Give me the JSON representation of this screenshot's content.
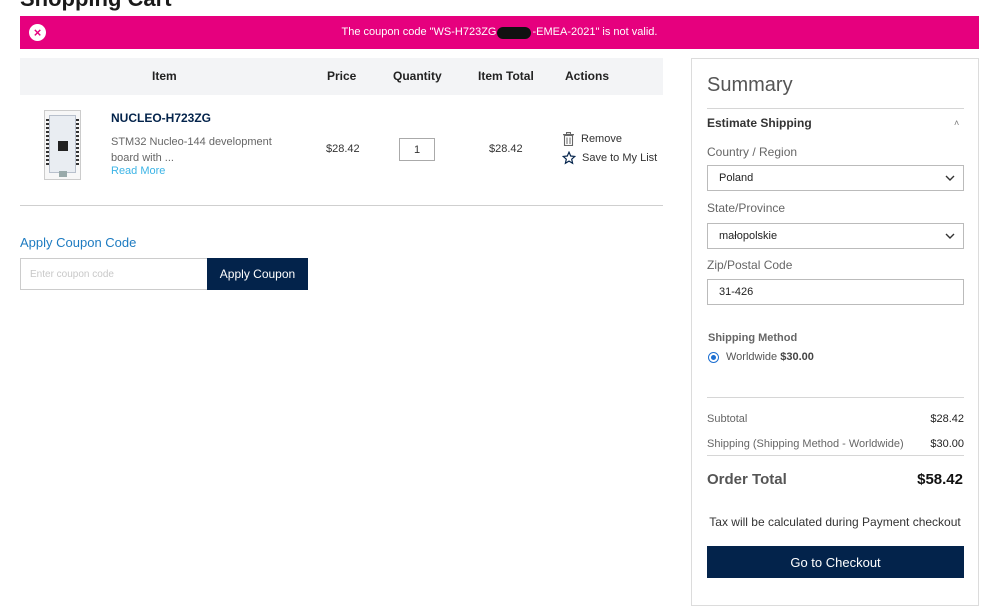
{
  "page": {
    "heading_fragment": "Shopping Cart"
  },
  "alert": {
    "message_prefix": "The coupon code \"WS-H723ZG",
    "message_suffix": "-EMEA-2021\" is not valid.",
    "color": "#e6007e"
  },
  "cart": {
    "headers": {
      "item": "Item",
      "price": "Price",
      "quantity": "Quantity",
      "item_total": "Item Total",
      "actions": "Actions"
    },
    "items": [
      {
        "name": "NUCLEO-H723ZG",
        "description": "STM32 Nucleo-144 development board with ...",
        "read_more": "Read More",
        "price": "$28.42",
        "quantity": "1",
        "item_total": "$28.42",
        "remove_label": "Remove",
        "save_label": "Save to My List"
      }
    ]
  },
  "coupon": {
    "title": "Apply Coupon Code",
    "placeholder": "Enter coupon code",
    "button_label": "Apply Coupon"
  },
  "summary": {
    "title": "Summary",
    "estimate_shipping": "Estimate Shipping",
    "country_label": "Country / Region",
    "country_value": "Poland",
    "state_label": "State/Province",
    "state_value": "małopolskie",
    "zip_label": "Zip/Postal Code",
    "zip_value": "31-426",
    "shipping_method_label": "Shipping Method",
    "shipping_option_name": "Worldwide",
    "shipping_option_price": "$30.00",
    "subtotal_label": "Subtotal",
    "subtotal_value": "$28.42",
    "shipping_label": "Shipping (Shipping Method - Worldwide)",
    "shipping_value": "$30.00",
    "order_total_label": "Order Total",
    "order_total_value": "$58.42",
    "tax_note": "Tax will be calculated during Payment checkout",
    "checkout_label": "Go to Checkout"
  },
  "colors": {
    "navy": "#03234b",
    "link_blue": "#1d7bc1",
    "pink": "#e6007e"
  }
}
